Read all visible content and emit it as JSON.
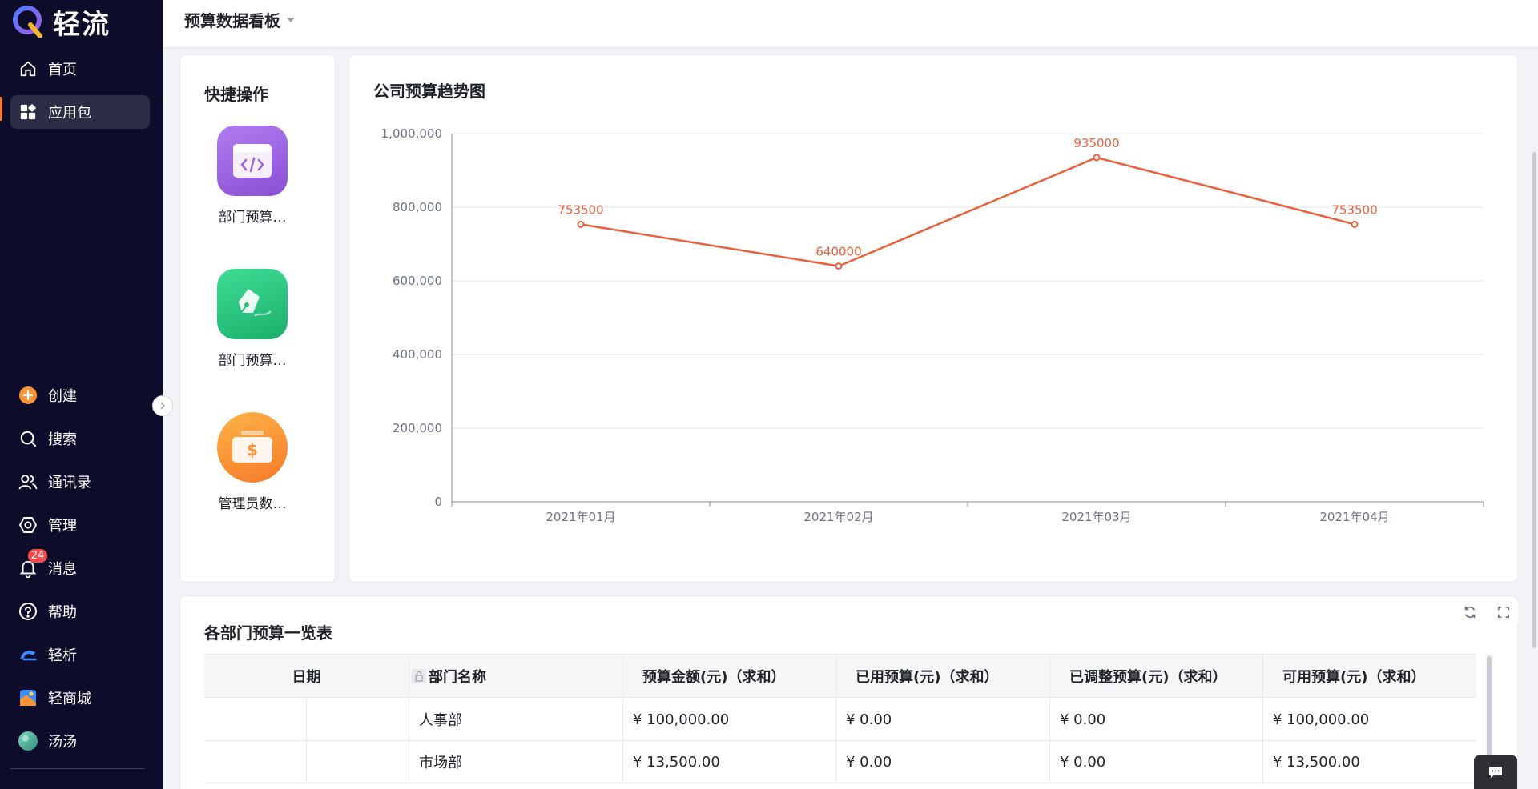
{
  "brand": {
    "name": "轻流"
  },
  "sidebar": {
    "top_items": [
      {
        "label": "首页",
        "icon": "home-icon"
      },
      {
        "label": "应用包",
        "icon": "apps-icon"
      }
    ],
    "bottom_items": [
      {
        "label": "创建",
        "icon": "plus-circle-icon"
      },
      {
        "label": "搜索",
        "icon": "search-icon"
      },
      {
        "label": "通讯录",
        "icon": "contacts-icon"
      },
      {
        "label": "管理",
        "icon": "manage-icon"
      },
      {
        "label": "消息",
        "icon": "bell-icon",
        "badge": "24"
      },
      {
        "label": "帮助",
        "icon": "help-icon"
      },
      {
        "label": "轻析",
        "icon": "qingxi-icon"
      },
      {
        "label": "轻商城",
        "icon": "store-icon"
      },
      {
        "label": "汤汤",
        "icon": "avatar"
      }
    ]
  },
  "header": {
    "title": "预算数据看板"
  },
  "quick_actions": {
    "title": "快捷操作",
    "items": [
      {
        "label": "部门预算…",
        "icon": "code-window-icon",
        "color": "#9b5de5"
      },
      {
        "label": "部门预算…",
        "icon": "pen-icon",
        "color": "#22c07a"
      },
      {
        "label": "管理员数…",
        "icon": "money-icon",
        "color": "#f7943a"
      }
    ]
  },
  "chart": {
    "title": "公司预算趋势图"
  },
  "chart_data": {
    "type": "line",
    "title": "公司预算趋势图",
    "categories": [
      "2021年01月",
      "2021年02月",
      "2021年03月",
      "2021年04月"
    ],
    "series": [
      {
        "values": [
          753500,
          640000,
          935000,
          753500
        ],
        "color": "#e8603c"
      }
    ],
    "data_labels": [
      "753500",
      "640000",
      "935000",
      "753500"
    ],
    "y_ticks": [
      "0",
      "200,000",
      "400,000",
      "600,000",
      "800,000",
      "1,000,000"
    ],
    "ylim": [
      0,
      1000000
    ],
    "grid": true
  },
  "table": {
    "title": "各部门预算一览表",
    "columns": [
      "日期",
      "部门名称",
      "预算金额(元)（求和）",
      "已用预算(元)（求和）",
      "已调整预算(元)（求和）",
      "可用预算(元)（求和）"
    ],
    "rows": [
      [
        "",
        "人事部",
        "¥ 100,000.00",
        "¥ 0.00",
        "¥ 0.00",
        "¥ 100,000.00"
      ],
      [
        "",
        "市场部",
        "¥ 13,500.00",
        "¥ 0.00",
        "¥ 0.00",
        "¥ 13,500.00"
      ]
    ]
  }
}
